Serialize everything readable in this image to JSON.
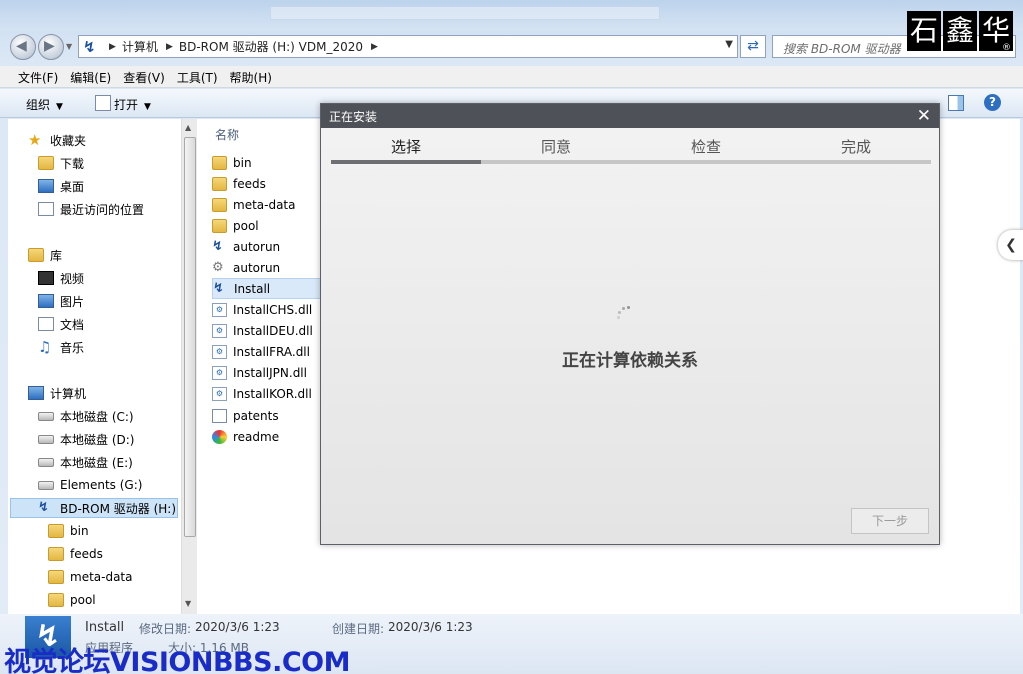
{
  "brand": {
    "chars": [
      "石",
      "鑫",
      "华"
    ],
    "reg": "®"
  },
  "address": {
    "path": [
      "计算机",
      "BD-ROM 驱动器 (H:) VDM_2020"
    ]
  },
  "search": {
    "placeholder": "搜索 BD-ROM 驱动器"
  },
  "menu": [
    "文件(F)",
    "编辑(E)",
    "查看(V)",
    "工具(T)",
    "帮助(H)"
  ],
  "toolbar": {
    "organize": "组织",
    "open": "打开"
  },
  "nav": {
    "favorites": "收藏夹",
    "fav_items": [
      "下载",
      "桌面",
      "最近访问的位置"
    ],
    "library": "库",
    "lib_items": [
      "视频",
      "图片",
      "文档",
      "音乐"
    ],
    "computer": "计算机",
    "drives": [
      "本地磁盘 (C:)",
      "本地磁盘 (D:)",
      "本地磁盘 (E:)",
      "Elements (G:)",
      "BD-ROM 驱动器 (H:)"
    ],
    "bd_items": [
      "bin",
      "feeds",
      "meta-data",
      "pool"
    ]
  },
  "files": {
    "column": "名称",
    "items": [
      "bin",
      "feeds",
      "meta-data",
      "pool",
      "autorun",
      "autorun",
      "Install",
      "InstallCHS.dll",
      "InstallDEU.dll",
      "InstallFRA.dll",
      "InstallJPN.dll",
      "InstallKOR.dll",
      "patents",
      "readme"
    ]
  },
  "dialog": {
    "title": "正在安装",
    "steps": [
      "选择",
      "同意",
      "检查",
      "完成"
    ],
    "progress": 0.25,
    "message": "正在计算依赖关系",
    "next": "下一步"
  },
  "status": {
    "name": "Install",
    "modified_label": "修改日期:",
    "modified": "2020/3/6 1:23",
    "created_label": "创建日期:",
    "created": "2020/3/6 1:23",
    "type": "应用程序",
    "size": "大小: 1.16 MB"
  },
  "watermark": "视觉论坛VISIONBBS.COM"
}
